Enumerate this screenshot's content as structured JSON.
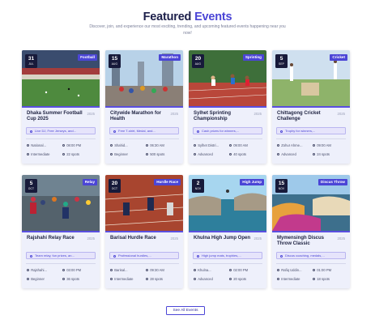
{
  "header": {
    "title_main": "Featured",
    "title_accent": "Events",
    "subtitle": "Discover, join, and experience our most exciting, trending, and upcoming featured events happening near you now!"
  },
  "events": [
    {
      "day": "31",
      "month": "JUL",
      "category": "Football",
      "title": "Dhaka Summer Football Cup 2025",
      "year": "2025",
      "tag": "Live DJ, Free Jerseys, and...",
      "location": "National...",
      "time": "08:00 PM",
      "level": "Intermediate",
      "spots": "22 spots"
    },
    {
      "day": "15",
      "month": "AUG",
      "category": "Marathon",
      "title": "Citywide Marathon for Health",
      "year": "2025",
      "tag": "Free T-shirt, Medal, and...",
      "location": "Shahid...",
      "time": "06:30 AM",
      "level": "Beginner",
      "spots": "500 spots"
    },
    {
      "day": "20",
      "month": "AUG",
      "category": "Sprinting",
      "title": "Sylhet Sprinting Championship",
      "year": "2025",
      "tag": "Cash prizes for winners,...",
      "location": "Sylhet Distri...",
      "time": "09:00 AM",
      "level": "Advanced",
      "spots": "40 spots"
    },
    {
      "day": "5",
      "month": "SEP",
      "category": "Cricket",
      "title": "Chittagong Cricket Challenge",
      "year": "2025",
      "tag": "Trophy for winners,...",
      "location": "Zohur Ahme...",
      "time": "09:00 AM",
      "level": "Advanced",
      "spots": "24 spots"
    },
    {
      "day": "5",
      "month": "OCT",
      "category": "Relay",
      "title": "Rajshahi Relay Race",
      "year": "2025",
      "tag": "Team relay, fun prizes, an...",
      "location": "Rajshahi...",
      "time": "03:00 PM",
      "level": "Beginner",
      "spots": "36 spots"
    },
    {
      "day": "20",
      "month": "OCT",
      "category": "Hurdle Race",
      "title": "Barisal Hurdle Race",
      "year": "2025",
      "tag": "Professional hurdles,...",
      "location": "Barisal...",
      "time": "09:30 AM",
      "level": "Intermediate",
      "spots": "28 spots"
    },
    {
      "day": "2",
      "month": "NOV",
      "category": "High Jump",
      "title": "Khulna High Jump Open",
      "year": "2025",
      "tag": "High jump mats, trophies,...",
      "location": "Khulna...",
      "time": "02:00 PM",
      "level": "Advanced",
      "spots": "20 spots"
    },
    {
      "day": "15",
      "month": "NOV",
      "category": "Discus Throw",
      "title": "Mymensingh Discus Throw Classic",
      "year": "2025",
      "tag": "Discus coaching, medals,...",
      "location": "Rafiq Uddin...",
      "time": "01:00 PM",
      "level": "Intermediate",
      "spots": "18 spots"
    }
  ],
  "see_all": "See All Events"
}
